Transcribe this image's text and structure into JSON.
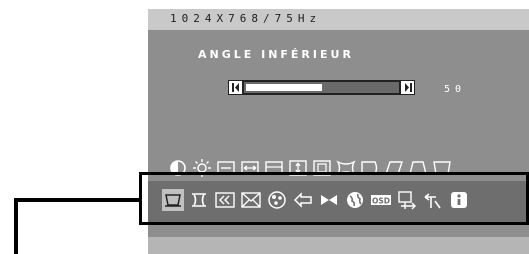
{
  "osd": {
    "resolution": "1024X768/75Hz",
    "menu_title": "ANGLE INFÉRIEUR",
    "slider": {
      "value": 50,
      "max": 100,
      "display_value": "50"
    },
    "top_icons": [
      "contrast-icon",
      "brightness-icon",
      "h-size-icon",
      "h-position-icon",
      "v-size-icon",
      "v-position-icon",
      "zoom-icon",
      "pincushion-icon",
      "trapezoid-icon",
      "parallelogram-icon",
      "top-corner-icon",
      "bottom-corner-icon"
    ],
    "bottom_icons": [
      "bottom-corner-icon",
      "pinbalance-icon",
      "rotation-icon",
      "moire-icon",
      "color-icon",
      "degauss-icon",
      "convergence-icon",
      "language-icon",
      "osd-icon",
      "h-osd-position-icon",
      "reset-icon",
      "info-icon"
    ],
    "bottom_selected_index": 0,
    "osd_badge": "OSD"
  }
}
